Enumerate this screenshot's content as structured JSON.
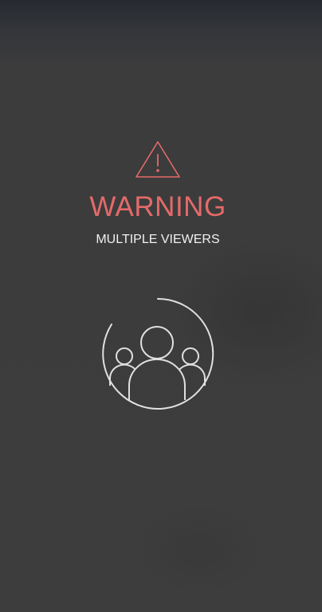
{
  "alert": {
    "icon": "warning-triangle-icon",
    "title": "WARNING",
    "subtitle": "MULTIPLE VIEWERS",
    "illustration": "multiple-people-icon"
  },
  "colors": {
    "background": "#3d3d3d",
    "accent": "#e46a6a",
    "text": "#f0f0f0",
    "illustration_stroke": "#e0e0e0"
  }
}
